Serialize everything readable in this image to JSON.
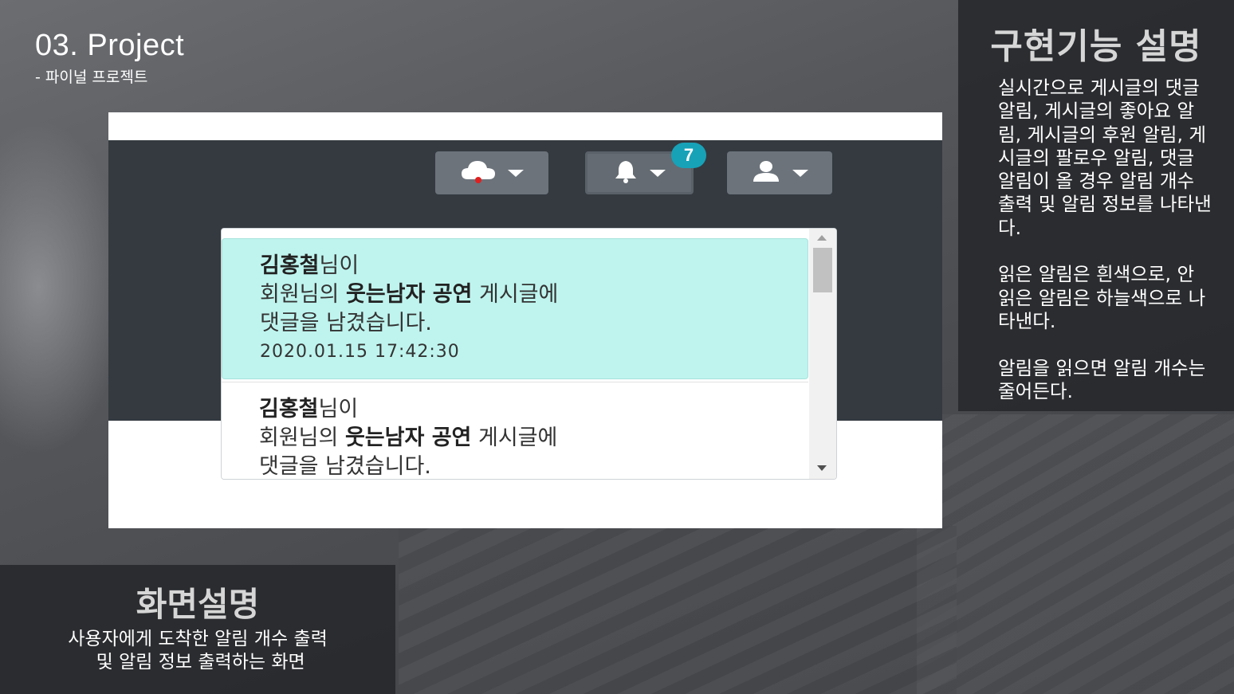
{
  "header": {
    "title": "03. Project",
    "subtitle": "- 파이널 프로젝트"
  },
  "screenshot": {
    "badge_count": "7",
    "icons": {
      "cloud": "cloud-icon",
      "bell": "bell-icon",
      "user": "user-icon"
    },
    "notifications": [
      {
        "state": "unread",
        "name": "김홍철",
        "suffix": "님이",
        "line2_pre": "회원님의 ",
        "post_title": "웃는남자 공연",
        "line2_post": " 게시글에",
        "line3": "댓글을 남겼습니다.",
        "date": "2020.01.15 17:42:30"
      },
      {
        "state": "read",
        "name": "김홍철",
        "suffix": "님이",
        "line2_pre": "회원님의 ",
        "post_title": "웃는남자 공연",
        "line2_post": " 게시글에",
        "line3": "댓글을 남겼습니다."
      }
    ]
  },
  "right_panel": {
    "title": "구현기능 설명",
    "body": "실시간으로 게시글의 댓글 알림, 게시글의 좋아요 알림, 게시글의 후원 알림, 게시글의 팔로우 알림, 댓글 알림이 올 경우 알림 개수 출력 및 알림 정보를 나타낸다.\n\n읽은 알림은 흰색으로, 안 읽은 알림은 하늘색으로 나타낸다.\n\n알림을 읽으면 알림 개수는 줄어든다."
  },
  "left_panel": {
    "title": "화면설명",
    "body": "사용자에게 도착한 알림 개수 출력\n 및 알림 정보 출력하는 화면"
  },
  "colors": {
    "unread_bg": "#bff4ee",
    "read_bg": "#ffffff",
    "badge": "#17a2b8",
    "navbar": "#343a40",
    "cloud_dot": "#e02020"
  }
}
